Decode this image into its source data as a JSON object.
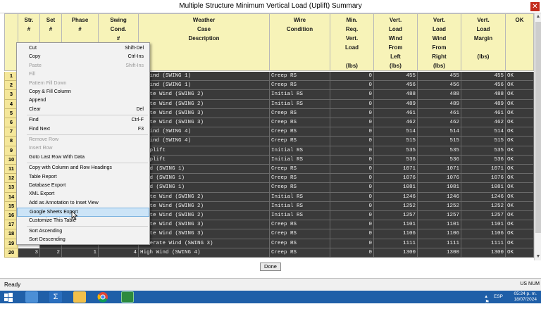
{
  "window": {
    "title": "Multiple Structure Minimum Vertical Load (Uplift) Summary",
    "close": "✕"
  },
  "columns": [
    "Str.\n#",
    "Set\n#",
    "Phase\n#",
    "Swing\nCond.\n#",
    "Weather\nCase\nDescription",
    "Wire\nCondition",
    "Min.\nReq.\nVert.\nLoad\n\n(lbs)",
    "Vert.\nLoad\nWind\nFrom\nLeft\n(lbs)",
    "Vert.\nLoad\nWind\nFrom\nRight\n(lbs)",
    "Vert.\nLoad\nMargin\n\n(lbs)",
    "OK"
  ],
  "rows": [
    {
      "n": "1",
      "str": "",
      "set": "",
      "phase": "",
      "swing": "",
      "weather": "n Wind (SWING 1)",
      "wire": "Creep RS",
      "min": "0",
      "left": "455",
      "right": "455",
      "margin": "455",
      "ok": "OK"
    },
    {
      "n": "2",
      "str": "",
      "set": "",
      "phase": "",
      "swing": "",
      "weather": "n Wind (SWING 1)",
      "wire": "Creep RS",
      "min": "0",
      "left": "456",
      "right": "456",
      "margin": "456",
      "ok": "OK"
    },
    {
      "n": "3",
      "str": "",
      "set": "",
      "phase": "",
      "swing": "",
      "weather": "erate Wind (SWING 2)",
      "wire": "Initial RS",
      "min": "0",
      "left": "488",
      "right": "488",
      "margin": "488",
      "ok": "OK"
    },
    {
      "n": "4",
      "str": "",
      "set": "",
      "phase": "",
      "swing": "",
      "weather": "erate Wind (SWING 2)",
      "wire": "Initial RS",
      "min": "0",
      "left": "489",
      "right": "489",
      "margin": "489",
      "ok": "OK"
    },
    {
      "n": "5",
      "str": "",
      "set": "",
      "phase": "",
      "swing": "",
      "weather": "erate Wind (SWING 3)",
      "wire": "Creep RS",
      "min": "0",
      "left": "461",
      "right": "461",
      "margin": "461",
      "ok": "OK"
    },
    {
      "n": "6",
      "str": "",
      "set": "",
      "phase": "",
      "swing": "",
      "weather": "erate Wind (SWING 3)",
      "wire": "Creep RS",
      "min": "0",
      "left": "462",
      "right": "462",
      "margin": "462",
      "ok": "OK"
    },
    {
      "n": "7",
      "str": "",
      "set": "",
      "phase": "",
      "swing": "",
      "weather": "n Wind (SWING 4)",
      "wire": "Creep RS",
      "min": "0",
      "left": "514",
      "right": "514",
      "margin": "514",
      "ok": "OK"
    },
    {
      "n": "8",
      "str": "",
      "set": "",
      "phase": "",
      "swing": "",
      "weather": "n Wind (SWING 4)",
      "wire": "Creep RS",
      "min": "0",
      "left": "515",
      "right": "515",
      "margin": "515",
      "ok": "OK"
    },
    {
      "n": "9",
      "str": "",
      "set": "",
      "phase": "",
      "swing": "",
      "weather": "d Uplift",
      "wire": "Initial RS",
      "min": "0",
      "left": "535",
      "right": "535",
      "margin": "535",
      "ok": "OK"
    },
    {
      "n": "10",
      "str": "",
      "set": "",
      "phase": "",
      "swing": "",
      "weather": "d Uplift",
      "wire": "Initial RS",
      "min": "0",
      "left": "536",
      "right": "536",
      "margin": "536",
      "ok": "OK"
    },
    {
      "n": "11",
      "str": "",
      "set": "",
      "phase": "",
      "swing": "",
      "weather": "Wind (SWING 1)",
      "wire": "Creep RS",
      "min": "0",
      "left": "1071",
      "right": "1071",
      "margin": "1071",
      "ok": "OK"
    },
    {
      "n": "12",
      "str": "",
      "set": "",
      "phase": "",
      "swing": "",
      "weather": "Wind (SWING 1)",
      "wire": "Creep RS",
      "min": "0",
      "left": "1076",
      "right": "1076",
      "margin": "1076",
      "ok": "OK"
    },
    {
      "n": "13",
      "str": "",
      "set": "",
      "phase": "",
      "swing": "",
      "weather": "Wind (SWING 1)",
      "wire": "Creep RS",
      "min": "0",
      "left": "1081",
      "right": "1081",
      "margin": "1081",
      "ok": "OK"
    },
    {
      "n": "14",
      "str": "",
      "set": "",
      "phase": "",
      "swing": "",
      "weather": "erate Wind (SWING 2)",
      "wire": "Initial RS",
      "min": "0",
      "left": "1246",
      "right": "1246",
      "margin": "1246",
      "ok": "OK"
    },
    {
      "n": "15",
      "str": "",
      "set": "",
      "phase": "",
      "swing": "",
      "weather": "erate Wind (SWING 2)",
      "wire": "Initial RS",
      "min": "0",
      "left": "1252",
      "right": "1252",
      "margin": "1252",
      "ok": "OK"
    },
    {
      "n": "16",
      "str": "",
      "set": "",
      "phase": "",
      "swing": "",
      "weather": "erate Wind (SWING 2)",
      "wire": "Initial RS",
      "min": "0",
      "left": "1257",
      "right": "1257",
      "margin": "1257",
      "ok": "OK"
    },
    {
      "n": "17",
      "str": "",
      "set": "",
      "phase": "",
      "swing": "",
      "weather": "erate Wind (SWING 3)",
      "wire": "Creep RS",
      "min": "0",
      "left": "1101",
      "right": "1101",
      "margin": "1101",
      "ok": "OK"
    },
    {
      "n": "18",
      "str": "",
      "set": "",
      "phase": "",
      "swing": "",
      "weather": "erate Wind (SWING 3)",
      "wire": "Creep RS",
      "min": "0",
      "left": "1106",
      "right": "1106",
      "margin": "1106",
      "ok": "OK"
    },
    {
      "n": "19",
      "str": "3",
      "set": "2",
      "phase": "3",
      "swing": "3",
      "weather": "Moderate Wind (SWING 3)",
      "wire": "Creep RS",
      "min": "0",
      "left": "1111",
      "right": "1111",
      "margin": "1111",
      "ok": "OK"
    },
    {
      "n": "20",
      "str": "3",
      "set": "2",
      "phase": "1",
      "swing": "4",
      "weather": "High Wind (SWING 4)",
      "wire": "Creep RS",
      "min": "0",
      "left": "1300",
      "right": "1300",
      "margin": "1300",
      "ok": "OK"
    }
  ],
  "context_menu": [
    {
      "label": "Cut",
      "shortcut": "Shift-Del",
      "disabled": false
    },
    {
      "label": "Copy",
      "shortcut": "Ctrl-Ins",
      "disabled": false
    },
    {
      "label": "Paste",
      "shortcut": "Shift-Ins",
      "disabled": true
    },
    {
      "label": "Fill",
      "shortcut": "",
      "disabled": true
    },
    {
      "label": "Pattern Fill Down",
      "shortcut": "",
      "disabled": true
    },
    {
      "label": "Copy & Fill Column",
      "shortcut": "",
      "disabled": false
    },
    {
      "label": "Append",
      "shortcut": "",
      "disabled": false
    },
    {
      "label": "Clear",
      "shortcut": "Del",
      "disabled": false
    },
    {
      "sep": true
    },
    {
      "label": "Find",
      "shortcut": "Ctrl-F",
      "disabled": false
    },
    {
      "label": "Find Next",
      "shortcut": "F3",
      "disabled": false
    },
    {
      "sep": true
    },
    {
      "label": "Remove Row",
      "shortcut": "",
      "disabled": true
    },
    {
      "label": "Insert Row",
      "shortcut": "",
      "disabled": true
    },
    {
      "label": "Goto Last Row With Data",
      "shortcut": "",
      "disabled": false
    },
    {
      "sep": true
    },
    {
      "label": "Copy with Column and Row Headings",
      "shortcut": "",
      "disabled": false
    },
    {
      "label": "Table Report",
      "shortcut": "",
      "disabled": false
    },
    {
      "label": "Database Export",
      "shortcut": "",
      "disabled": false
    },
    {
      "label": "XML Export",
      "shortcut": "",
      "disabled": false
    },
    {
      "label": "Add as Annotation to Inset View",
      "shortcut": "",
      "disabled": false
    },
    {
      "label": "Google Sheets Export",
      "shortcut": "",
      "disabled": false,
      "highlight": true
    },
    {
      "label": "Customize This Table",
      "shortcut": "",
      "disabled": false
    },
    {
      "sep": true
    },
    {
      "label": "Sort Ascending",
      "shortcut": "",
      "disabled": false
    },
    {
      "label": "Sort Descending",
      "shortcut": "",
      "disabled": false
    }
  ],
  "done_label": "Done",
  "status": {
    "ready": "Ready",
    "right": "US  NUM"
  },
  "taskbar": {
    "lang": "ESP",
    "time": "05:24 p. m.",
    "date": "18/07/2024"
  }
}
